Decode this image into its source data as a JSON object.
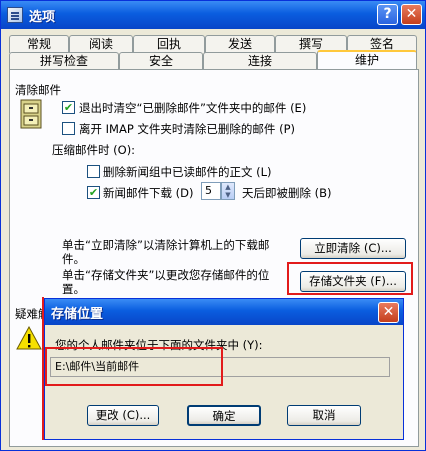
{
  "window": {
    "title": "选项",
    "help_label": "?",
    "close_label": "✕"
  },
  "tabs_row1": [
    "常规",
    "阅读",
    "回执",
    "发送",
    "撰写",
    "签名"
  ],
  "tabs_row2": [
    "拼写检查",
    "安全",
    "连接",
    "维护"
  ],
  "active_tab": "维护",
  "cleanup": {
    "group_label": "清除邮件",
    "empty_deleted": {
      "label": "退出时清空“已删除邮件”文件夹中的邮件 (E)",
      "checked": true
    },
    "purge_imap": {
      "label": "离开 IMAP 文件夹时清除已删除的邮件 (P)",
      "checked": false
    },
    "compact_label": "压缩邮件时 (O):",
    "delete_read_news": {
      "label": "删除新闻组中已读邮件的正文 (L)",
      "checked": false
    },
    "news_download": {
      "label": "新闻邮件下载 (D)",
      "checked": true
    },
    "days_value": "5",
    "days_suffix": "天后即被删除 (B)",
    "clean_text": "单击“立即清除”以清除计算机上的下载邮件。",
    "clean_button": "立即清除 (C)...",
    "store_text": "单击“存储文件夹”以更改您存储邮件的位置。",
    "store_button": "存储文件夹 (F)..."
  },
  "troubleshoot": {
    "label": "疑难解"
  },
  "store_dialog": {
    "title": "存储位置",
    "close_label": "✕",
    "description": "您的个人邮件夹位于下面的文件夹中 (Y):",
    "path": "E:\\邮件\\当前邮件",
    "change_button": "更改 (C)...",
    "ok_button": "确定",
    "cancel_button": "取消"
  }
}
